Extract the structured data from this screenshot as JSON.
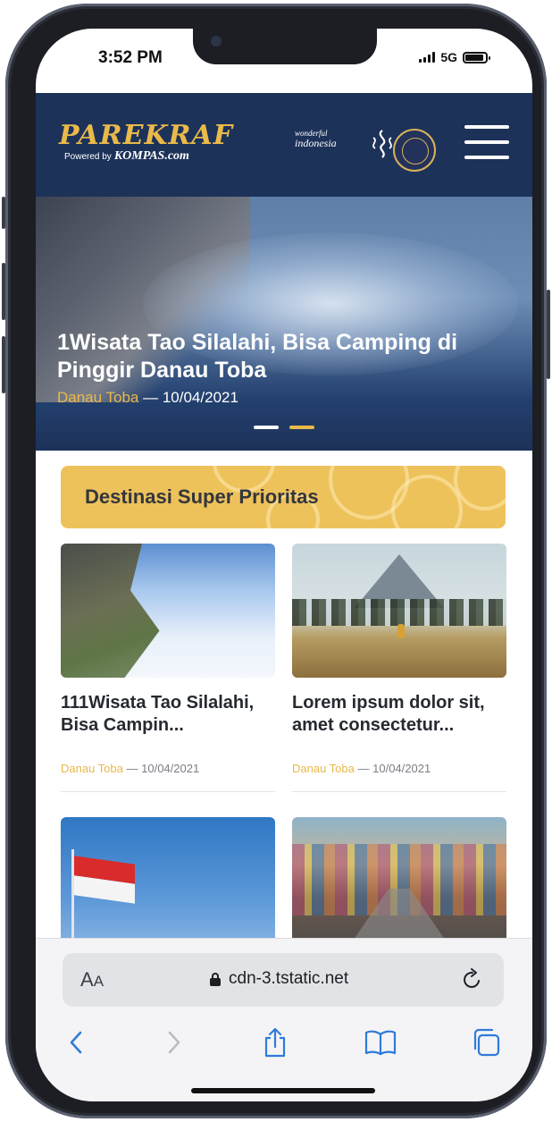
{
  "status_bar": {
    "time": "3:52 PM",
    "network": "5G"
  },
  "header": {
    "logo_title": "PAREKRAF",
    "logo_powered": "Powered by",
    "logo_brand": "KOMPAS.com",
    "wonderful_small": "wonderful",
    "wonderful_big": "indonesia",
    "menu_icon": "hamburger-menu-icon"
  },
  "hero": {
    "title": "1Wisata Tao Silalahi, Bisa Camping di Pinggir Danau Toba",
    "category": "Danau Toba",
    "separator": "—",
    "date": "10/04/2021",
    "slides_total": 2,
    "slide_active": 2
  },
  "section": {
    "title": "Destinasi Super Prioritas"
  },
  "cards": [
    {
      "title": "111Wisata Tao Silalahi, Bisa Campin...",
      "category": "Danau Toba",
      "separator": "—",
      "date": "10/04/2021"
    },
    {
      "title": "Lorem ipsum dolor sit, amet consectetur...",
      "category": "Danau Toba",
      "separator": "—",
      "date": "10/04/2021"
    },
    {
      "title": "",
      "category": "",
      "separator": "",
      "date": ""
    },
    {
      "title": "",
      "category": "",
      "separator": "",
      "date": ""
    }
  ],
  "safari": {
    "aa_large": "A",
    "aa_small": "A",
    "url": "cdn-3.tstatic.net",
    "icons": [
      "back-icon",
      "forward-icon",
      "share-icon",
      "bookmarks-icon",
      "tabs-icon",
      "reload-icon",
      "lock-icon"
    ]
  },
  "colors": {
    "header_bg": "#1d3259",
    "accent_gold": "#e9b94a",
    "banner_bg": "#eec25b",
    "ios_blue": "#2f7bd9"
  }
}
